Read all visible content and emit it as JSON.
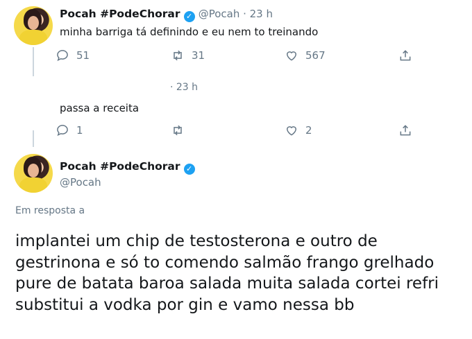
{
  "tweet1": {
    "name": "Pocah #PodeChorar",
    "handle": "@Pocah · 23 h",
    "text": "minha barriga tá definindo e eu nem to treinando",
    "replies": "51",
    "retweets": "31",
    "likes": "567"
  },
  "tweet2": {
    "time": "· 23 h",
    "text": "passa a receita",
    "replies": "1",
    "retweets": "",
    "likes": "2"
  },
  "tweet3": {
    "name": "Pocah #PodeChorar",
    "handle": "@Pocah",
    "reply_label": "Em resposta a",
    "lines": [
      "implantei um chip de testosterona e outro de",
      "gestrinona e só to comendo salmão frango grelhado",
      "pure de batata baroa salada muita salada cortei refri",
      "substitui a vodka por gin e vamo nessa bb"
    ]
  },
  "colors": {
    "accent": "#1da1f2",
    "secondary_text": "#657786",
    "thread_line": "#ccd6dd"
  },
  "icons": [
    "reply-icon",
    "retweet-icon",
    "like-icon",
    "share-icon",
    "verified-badge-icon"
  ]
}
